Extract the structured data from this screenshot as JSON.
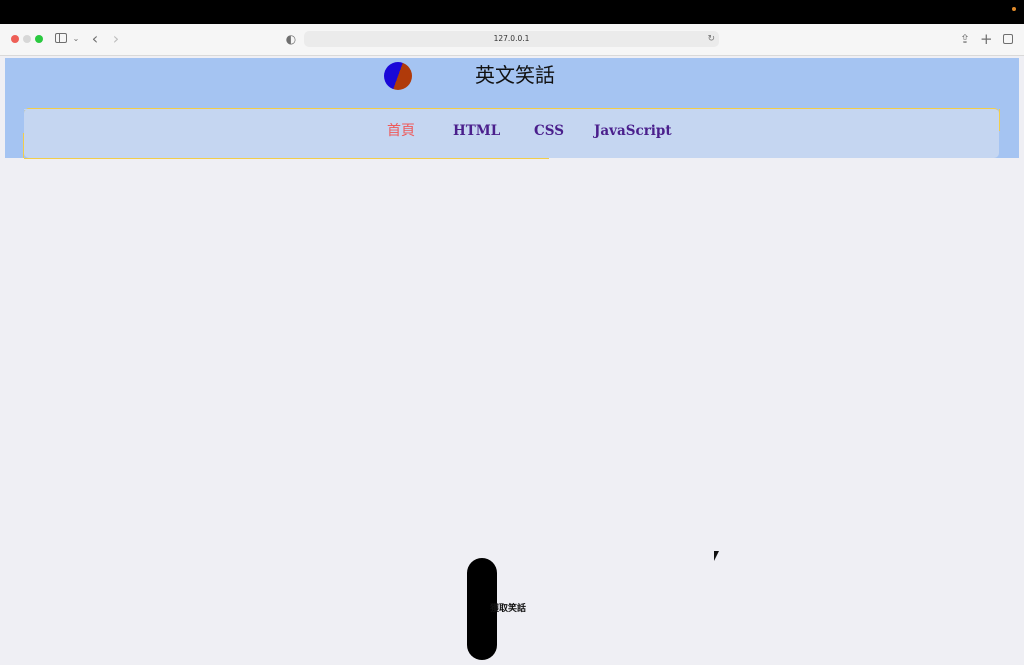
{
  "browser": {
    "url": "127.0.0.1"
  },
  "site": {
    "title": "英文笑話"
  },
  "nav": {
    "items": [
      {
        "label": "首頁",
        "active": true
      },
      {
        "label": "HTML"
      },
      {
        "label": "CSS"
      },
      {
        "label": "JavaScript"
      }
    ]
  },
  "main": {
    "fetch_button_label": "獲取笑話"
  },
  "colors": {
    "header_bg": "#a5c4f2",
    "nav_bg": "#c5d6f1",
    "nav_active": "#ee5a5a",
    "nav_link": "#4a1f8c",
    "nav_border": "#f1cd4b",
    "button_bg": "#000000"
  },
  "icons": {
    "sidebar": "sidebar-icon",
    "back": "chevron-left-icon",
    "forward": "chevron-right-icon",
    "privacy": "shield-icon",
    "reload": "reload-icon",
    "share": "share-icon",
    "new_tab": "plus-icon",
    "tab_overview": "tabs-icon",
    "logo": "logo-icon"
  }
}
